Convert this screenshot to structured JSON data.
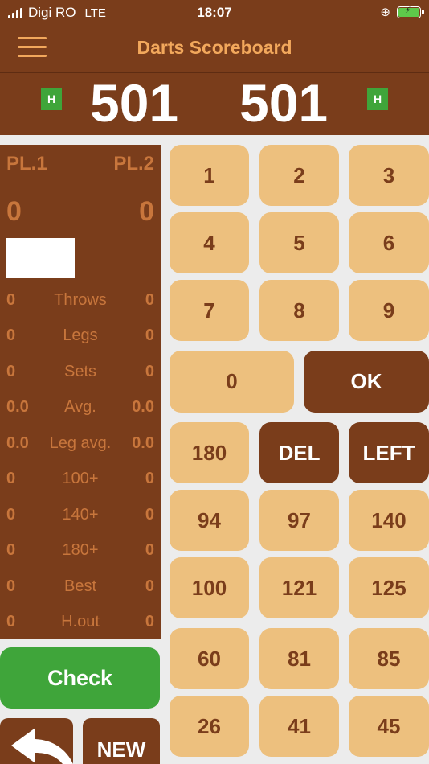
{
  "status_bar": {
    "carrier": "Digi RO",
    "network": "LTE",
    "time": "18:07",
    "orientation_icon": "orientation-lock-icon",
    "battery_icon": "battery-charging-icon"
  },
  "nav": {
    "title": "Darts Scoreboard",
    "menu_icon": "hamburger-menu-icon"
  },
  "scoreboard": {
    "player1_score": "501",
    "player2_score": "501",
    "player1_badge": "H",
    "player2_badge": "H"
  },
  "stats": {
    "player1_label": "PL.1",
    "player2_label": "PL.2",
    "player1_total": "0",
    "player2_total": "0",
    "rows": [
      {
        "p1": "0",
        "label": "Throws",
        "p2": "0"
      },
      {
        "p1": "0",
        "label": "Legs",
        "p2": "0"
      },
      {
        "p1": "0",
        "label": "Sets",
        "p2": "0"
      },
      {
        "p1": "0.0",
        "label": "Avg.",
        "p2": "0.0"
      },
      {
        "p1": "0.0",
        "label": "Leg avg.",
        "p2": "0.0"
      },
      {
        "p1": "0",
        "label": "100+",
        "p2": "0"
      },
      {
        "p1": "0",
        "label": "140+",
        "p2": "0"
      },
      {
        "p1": "0",
        "label": "180+",
        "p2": "0"
      },
      {
        "p1": "0",
        "label": "Best",
        "p2": "0"
      },
      {
        "p1": "0",
        "label": "H.out",
        "p2": "0"
      }
    ]
  },
  "actions": {
    "check_label": "Check",
    "new_label": "NEW",
    "back_icon": "undo-arrow-icon"
  },
  "keypad": {
    "digits": [
      "1",
      "2",
      "3",
      "4",
      "5",
      "6",
      "7",
      "8",
      "9",
      "0"
    ],
    "ok": "OK",
    "del": "DEL",
    "left": "LEFT",
    "k180": "180",
    "quick": [
      "94",
      "97",
      "140",
      "100",
      "121",
      "125",
      "60",
      "81",
      "85",
      "26",
      "41",
      "45"
    ]
  },
  "colors": {
    "brown": "#7a3d1b",
    "key_tan": "#edc07e",
    "accent_orange": "#f2a85c",
    "green": "#3fa53a",
    "background": "#ececec"
  }
}
